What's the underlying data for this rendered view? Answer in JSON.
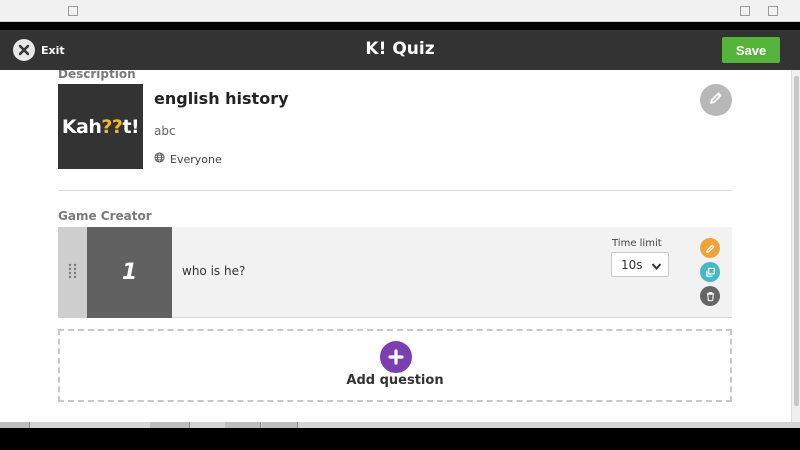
{
  "header": {
    "exit_label": "Exit",
    "brand_logo": "K!",
    "brand_title": "Quiz",
    "save_label": "Save",
    "save_color": "#57b43a",
    "header_bg": "#333333"
  },
  "details": {
    "section_heading": "Description",
    "cover_text_left": "Kah",
    "cover_text_mid": "??",
    "cover_text_right": "t!",
    "title": "english history",
    "description": "abc",
    "visibility": "Everyone",
    "visibility_icon": "globe-icon",
    "edit_icon": "pencil-icon"
  },
  "game_creator": {
    "section_heading": "Game Creator",
    "questions": [
      {
        "number": "1",
        "text": "who is he?",
        "time_limit_label": "Time limit",
        "time_limit_value": "10s"
      }
    ],
    "action_icons": [
      "pencil-icon",
      "duplicate-icon",
      "trash-icon"
    ],
    "action_colors": [
      "#f0a33a",
      "#45b8c8",
      "#666666"
    ],
    "add_question_label": "Add question",
    "add_icon": "plus-icon",
    "add_color": "#7b3fb0"
  }
}
